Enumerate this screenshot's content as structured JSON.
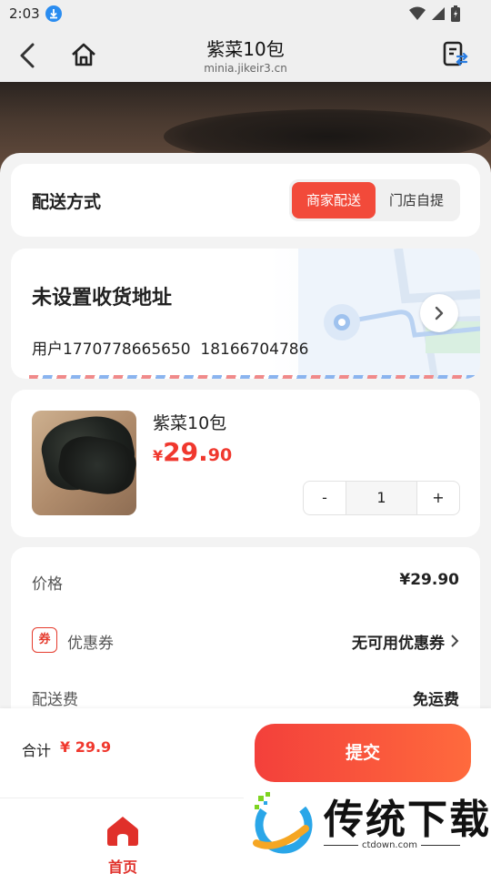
{
  "status_bar": {
    "time": "2:03"
  },
  "nav": {
    "title": "紫菜10包",
    "url": "minia.jikeir3.cn"
  },
  "delivery": {
    "label": "配送方式",
    "options": [
      "商家配送",
      "门店自提"
    ],
    "selected": "商家配送"
  },
  "address": {
    "title": "未设置收货地址",
    "user": "用户1770778665650",
    "phone": "18166704786"
  },
  "product": {
    "name": "紫菜10包",
    "price_symbol": "¥",
    "price_int": "29.",
    "price_dec": "90",
    "quantity": "1",
    "minus": "-",
    "plus": "+"
  },
  "summary": {
    "price_label": "价格",
    "price_value": "¥29.90",
    "coupon_badge": "券",
    "coupon_label": "优惠券",
    "coupon_value": "无可用优惠券",
    "shipping_label": "配送费",
    "shipping_value": "免运费"
  },
  "footer": {
    "total_label": "合计",
    "total_value": "¥ 29.9",
    "submit_label": "提交"
  },
  "tabbar": {
    "home_label": "首页"
  },
  "watermark": {
    "brand": "传统下载",
    "site": "ctdown.com"
  },
  "colors": {
    "accent": "#f24a3a",
    "price": "#f0382e",
    "background": "#f3f3f3"
  },
  "icons": [
    "download-icon",
    "wifi-icon",
    "signal-icon",
    "battery-icon",
    "back-arrow-icon",
    "home-icon",
    "share-icon",
    "chevron-right-icon",
    "home-tab-icon"
  ]
}
